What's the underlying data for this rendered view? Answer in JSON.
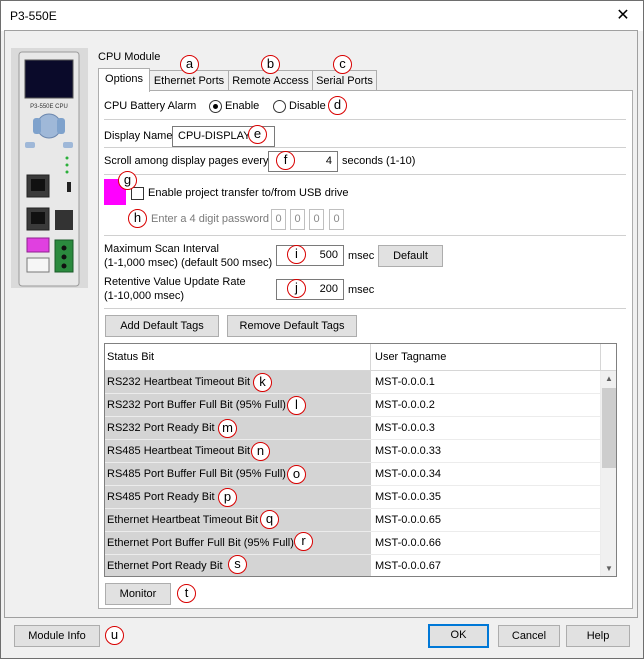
{
  "window": {
    "title": "P3-550E",
    "close_glyph": "✕"
  },
  "module_label": "CPU Module",
  "device_image_text": "P3-550E CPU",
  "tabs": [
    {
      "label": "Options",
      "active": true
    },
    {
      "label": "Ethernet Ports",
      "active": false
    },
    {
      "label": "Remote Access",
      "active": false
    },
    {
      "label": "Serial Ports",
      "active": false
    }
  ],
  "battery": {
    "label": "CPU Battery Alarm",
    "enable_label": "Enable",
    "disable_label": "Disable",
    "selected": "Enable"
  },
  "display_name": {
    "label": "Display Name",
    "value": "CPU-DISPLAY"
  },
  "scroll": {
    "label": "Scroll among display pages every",
    "value": "4",
    "unit": "seconds (1-10)"
  },
  "usb": {
    "label": "Enable project transfer to/from USB drive",
    "checked": false,
    "password_label": "Enter a 4 digit password",
    "digits": [
      "0",
      "0",
      "0",
      "0"
    ],
    "swatch_color": "#ff00ff"
  },
  "scan": {
    "label_line1": "Maximum Scan Interval",
    "label_line2": "(1-1,000 msec) (default 500 msec)",
    "value": "500",
    "unit": "msec",
    "default_button": "Default"
  },
  "retentive": {
    "label_line1": "Retentive Value Update Rate",
    "label_line2": "(1-10,000 msec)",
    "value": "200",
    "unit": "msec"
  },
  "tag_buttons": {
    "add": "Add Default Tags",
    "remove": "Remove Default Tags"
  },
  "table": {
    "columns": [
      "Status Bit",
      "User Tagname"
    ],
    "rows": [
      [
        "RS232 Heartbeat Timeout Bit",
        "MST-0.0.0.1"
      ],
      [
        "RS232 Port Buffer Full Bit (95% Full)",
        "MST-0.0.0.2"
      ],
      [
        "RS232 Port Ready Bit",
        "MST-0.0.0.3"
      ],
      [
        "RS485 Heartbeat Timeout Bit",
        "MST-0.0.0.33"
      ],
      [
        "RS485 Port Buffer Full Bit (95% Full)",
        "MST-0.0.0.34"
      ],
      [
        "RS485 Port Ready Bit",
        "MST-0.0.0.35"
      ],
      [
        "Ethernet Heartbeat Timeout Bit",
        "MST-0.0.0.65"
      ],
      [
        "Ethernet Port Buffer Full Bit (95% Full)",
        "MST-0.0.0.66"
      ],
      [
        "Ethernet Port Ready Bit",
        "MST-0.0.0.67"
      ]
    ]
  },
  "monitor_button": "Monitor",
  "footer": {
    "module_info": "Module Info",
    "ok": "OK",
    "cancel": "Cancel",
    "help": "Help"
  },
  "markers": [
    "a",
    "b",
    "c",
    "d",
    "e",
    "f",
    "g",
    "h",
    "i",
    "j",
    "k",
    "l",
    "m",
    "n",
    "o",
    "p",
    "q",
    "r",
    "s",
    "t",
    "u"
  ],
  "colors": {
    "marker_ring": "#d80000",
    "focus": "#0078d7",
    "swatch": "#ff00ff",
    "status_column": "#d4d4d4"
  }
}
